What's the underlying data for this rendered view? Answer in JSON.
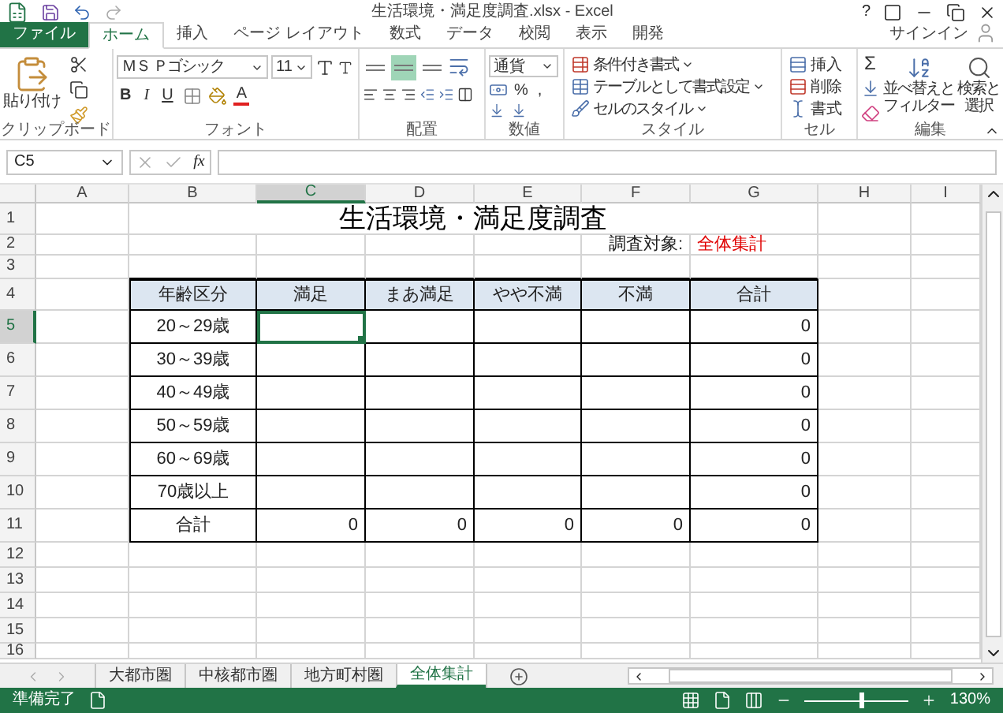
{
  "title_bar": {
    "title": "生活環境・満足度調査.xlsx - Excel",
    "help": "?"
  },
  "ribbon_tabs": [
    {
      "label": "ファイル",
      "kind": "file",
      "selected": false
    },
    {
      "label": "ホーム",
      "kind": "tab",
      "selected": true
    },
    {
      "label": "挿入",
      "kind": "tab",
      "selected": false
    },
    {
      "label": "ページ レイアウト",
      "kind": "tab",
      "selected": false
    },
    {
      "label": "数式",
      "kind": "tab",
      "selected": false
    },
    {
      "label": "データ",
      "kind": "tab",
      "selected": false
    },
    {
      "label": "校閲",
      "kind": "tab",
      "selected": false
    },
    {
      "label": "表示",
      "kind": "tab",
      "selected": false
    },
    {
      "label": "開発",
      "kind": "tab",
      "selected": false
    }
  ],
  "sign_in": "サインイン",
  "ribbon": {
    "clipboard": {
      "label": "クリップボード",
      "paste": "貼り付け"
    },
    "font": {
      "label": "フォント",
      "name": "ＭＳ Ｐゴシック",
      "size": "11",
      "bold": "B",
      "italic": "I",
      "underline": "U",
      "color_letter": "A"
    },
    "alignment": {
      "label": "配置",
      "vertical": [
        {
          "selected": false
        },
        {
          "selected": true
        },
        {
          "selected": false
        }
      ]
    },
    "number": {
      "label": "数値",
      "format": "通貨",
      "percent": "%",
      "comma": ","
    },
    "styles": {
      "label": "スタイル",
      "items": [
        "条件付き書式",
        "テーブルとして書式設定",
        "セルのスタイル"
      ]
    },
    "cells": {
      "label": "セル",
      "items": [
        "挿入",
        "削除",
        "書式"
      ]
    },
    "editing": {
      "label": "編集",
      "sum": "Σ",
      "sort": [
        "並べ替えと",
        "フィルター"
      ],
      "find": [
        "検索と",
        "選択"
      ]
    }
  },
  "formula_bar": {
    "name_box": "C5",
    "function_label": "fx"
  },
  "sheet": {
    "columns": [
      {
        "label": "A",
        "selected": false
      },
      {
        "label": "B",
        "selected": false
      },
      {
        "label": "C",
        "selected": true
      },
      {
        "label": "D",
        "selected": false
      },
      {
        "label": "E",
        "selected": false
      },
      {
        "label": "F",
        "selected": false
      },
      {
        "label": "G",
        "selected": false
      },
      {
        "label": "H",
        "selected": false
      },
      {
        "label": "I",
        "selected": false
      }
    ],
    "rows": [
      {
        "number": "1",
        "selected": false
      },
      {
        "number": "2",
        "selected": false
      },
      {
        "number": "3",
        "selected": false
      },
      {
        "number": "4",
        "selected": false
      },
      {
        "number": "5",
        "selected": true
      },
      {
        "number": "6",
        "selected": false
      },
      {
        "number": "7",
        "selected": false
      },
      {
        "number": "8",
        "selected": false
      },
      {
        "number": "9",
        "selected": false
      },
      {
        "number": "10",
        "selected": false
      },
      {
        "number": "11",
        "selected": false
      },
      {
        "number": "12",
        "selected": false
      },
      {
        "number": "13",
        "selected": false
      },
      {
        "number": "14",
        "selected": false
      },
      {
        "number": "15",
        "selected": false
      },
      {
        "number": "16",
        "selected": false
      }
    ],
    "title": "生活環境・満足度調査",
    "target_label": "調査対象:",
    "target_value": "全体集計",
    "table": {
      "header": [
        "年齢区分",
        "満足",
        "まあ満足",
        "やや不満",
        "不満",
        "合計"
      ],
      "rows": [
        {
          "label": "20～29歳",
          "total": "0"
        },
        {
          "label": "30～39歳",
          "total": "0"
        },
        {
          "label": "40～49歳",
          "total": "0"
        },
        {
          "label": "50～59歳",
          "total": "0"
        },
        {
          "label": "60～69歳",
          "total": "0"
        },
        {
          "label": "70歳以上",
          "total": "0"
        }
      ],
      "total_row": {
        "label": "合計",
        "values": [
          "0",
          "0",
          "0",
          "0",
          "0"
        ]
      }
    }
  },
  "sheet_tabs": [
    {
      "label": "大都市圏",
      "selected": false
    },
    {
      "label": "中核都市圏",
      "selected": false
    },
    {
      "label": "地方町村圏",
      "selected": false
    },
    {
      "label": "全体集計",
      "selected": true
    }
  ],
  "status_bar": {
    "text": "準備完了",
    "zoom": "130%",
    "zoom_slider": {
      "level": 0.54
    }
  }
}
